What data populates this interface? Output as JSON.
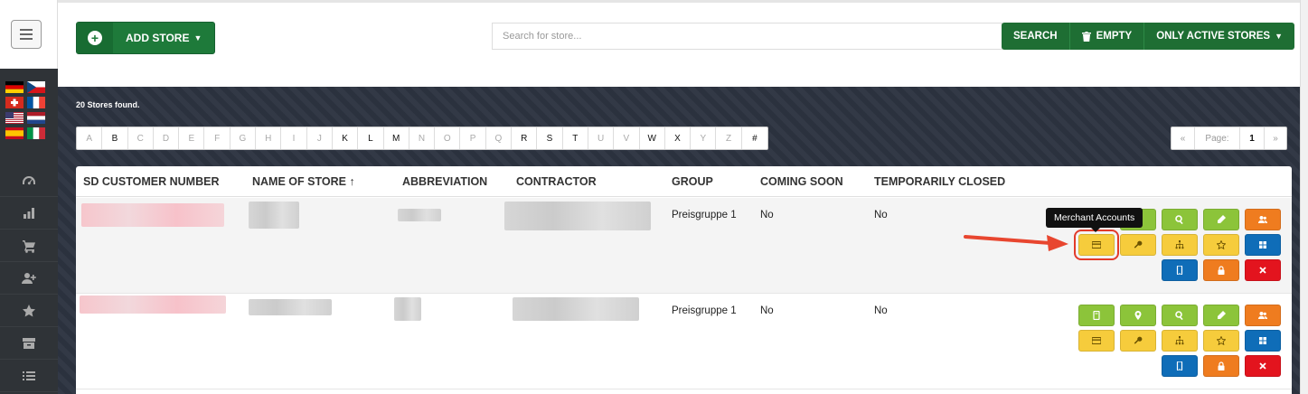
{
  "toolbar": {
    "add_store_label": "ADD STORE",
    "search_placeholder": "Search for store...",
    "search_label": "SEARCH",
    "empty_label": "EMPTY",
    "only_active_label": "ONLY ACTIVE STORES"
  },
  "results": {
    "count_text": "20 Stores found."
  },
  "alphabet": [
    {
      "letter": "A",
      "active": false
    },
    {
      "letter": "B",
      "active": true
    },
    {
      "letter": "C",
      "active": false
    },
    {
      "letter": "D",
      "active": false
    },
    {
      "letter": "E",
      "active": false
    },
    {
      "letter": "F",
      "active": false
    },
    {
      "letter": "G",
      "active": false
    },
    {
      "letter": "H",
      "active": false
    },
    {
      "letter": "I",
      "active": false
    },
    {
      "letter": "J",
      "active": false
    },
    {
      "letter": "K",
      "active": true
    },
    {
      "letter": "L",
      "active": true
    },
    {
      "letter": "M",
      "active": true
    },
    {
      "letter": "N",
      "active": false
    },
    {
      "letter": "O",
      "active": false
    },
    {
      "letter": "P",
      "active": false
    },
    {
      "letter": "Q",
      "active": false
    },
    {
      "letter": "R",
      "active": true
    },
    {
      "letter": "S",
      "active": true
    },
    {
      "letter": "T",
      "active": true
    },
    {
      "letter": "U",
      "active": false
    },
    {
      "letter": "V",
      "active": false
    },
    {
      "letter": "W",
      "active": true
    },
    {
      "letter": "X",
      "active": true
    },
    {
      "letter": "Y",
      "active": false
    },
    {
      "letter": "Z",
      "active": false
    },
    {
      "letter": "#",
      "active": true
    }
  ],
  "pager": {
    "prev": "«",
    "label": "Page:",
    "current": "1",
    "next": "»"
  },
  "table": {
    "columns": [
      "SD CUSTOMER NUMBER",
      "NAME OF STORE ↑",
      "ABBREVIATION",
      "CONTRACTOR",
      "GROUP",
      "COMING SOON",
      "TEMPORARILY CLOSED"
    ],
    "rows": [
      {
        "group": "Preisgruppe 1",
        "coming_soon": "No",
        "temporarily_closed": "No"
      },
      {
        "group": "Preisgruppe 1",
        "coming_soon": "No",
        "temporarily_closed": "No"
      }
    ]
  },
  "tooltip": {
    "text": "Merchant Accounts"
  },
  "colors": {
    "brand_green": "#1e7a3a",
    "action_green": "#8cc43a",
    "action_orange": "#ef7c1f",
    "action_yellow": "#f6cc3c",
    "action_blue": "#0f6db8",
    "action_red": "#e3141e",
    "highlight": "#e23b2a"
  },
  "icons": {
    "sidebar": [
      "dashboard-icon",
      "bar-chart-icon",
      "cart-icon",
      "user-plus-icon",
      "star-icon",
      "archive-icon",
      "list-icon"
    ],
    "flags": [
      "flag-de",
      "flag-cz",
      "flag-ch",
      "flag-fr",
      "flag-us",
      "flag-nl",
      "flag-es",
      "flag-it"
    ]
  }
}
